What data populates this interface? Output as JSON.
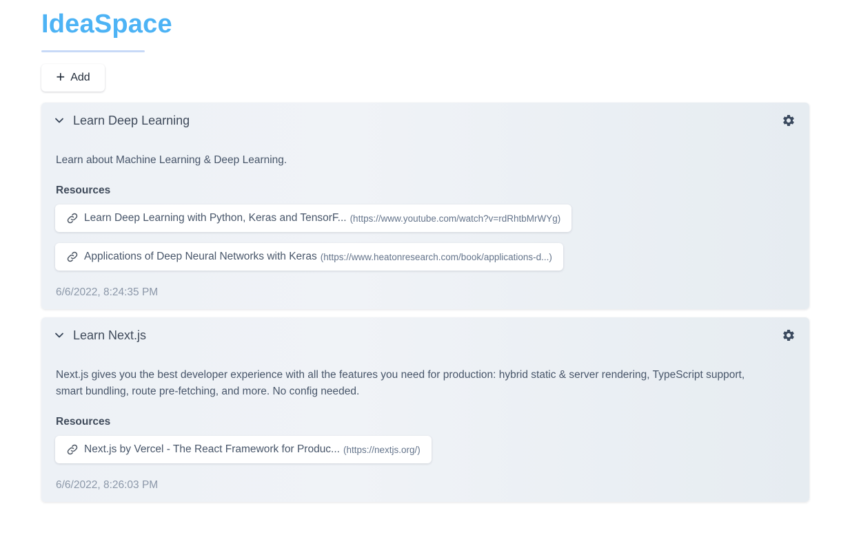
{
  "app": {
    "brand": "IdeaSpace",
    "add_label": "Add"
  },
  "colors": {
    "brand": "#4db3f5",
    "card_background": "#edf1f6",
    "text": "#475569"
  },
  "ideas": [
    {
      "title": "Learn Deep Learning",
      "description": "Learn about Machine Learning & Deep Learning.",
      "resources_heading": "Resources",
      "resources": [
        {
          "title": "Learn Deep Learning with Python, Keras and TensorF...",
          "url": "(https://www.youtube.com/watch?v=rdRhtbMrWYg)"
        },
        {
          "title": "Applications of Deep Neural Networks with Keras",
          "url": "(https://www.heatonresearch.com/book/applications-d...)"
        }
      ],
      "timestamp": "6/6/2022, 8:24:35 PM"
    },
    {
      "title": "Learn Next.js",
      "description": "Next.js gives you the best developer experience with all the features you need for production: hybrid static & server rendering, TypeScript support, smart bundling, route pre-fetching, and more. No config needed.",
      "resources_heading": "Resources",
      "resources": [
        {
          "title": "Next.js by Vercel - The React Framework for Produc...",
          "url": "(https://nextjs.org/)"
        }
      ],
      "timestamp": "6/6/2022, 8:26:03 PM"
    }
  ],
  "icons": {
    "add": "plus-icon",
    "collapse": "chevron-down-icon",
    "settings": "gear-icon",
    "resource": "link-icon"
  }
}
